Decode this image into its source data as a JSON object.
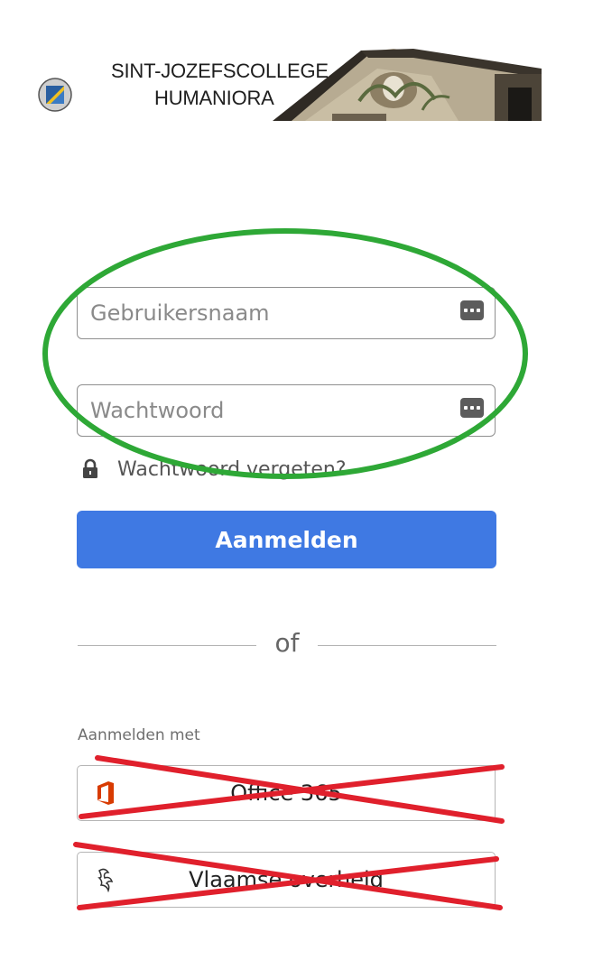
{
  "logo": {
    "line1": "SINT-JOZEFSCOLLEGE",
    "line2": "HUMANIORA"
  },
  "form": {
    "username_placeholder": "Gebruikersnaam",
    "password_placeholder": "Wachtwoord",
    "forgot_label": "Wachtwoord vergeten?",
    "submit_label": "Aanmelden"
  },
  "separator": {
    "label": "of"
  },
  "sso": {
    "heading": "Aanmelden met",
    "office_label": "Office 365",
    "vlaanderen_label": "Vlaamse overheid"
  },
  "colors": {
    "primary": "#3f79e3",
    "annotation_oval": "#2ea836",
    "annotation_cross": "#e0202c"
  }
}
